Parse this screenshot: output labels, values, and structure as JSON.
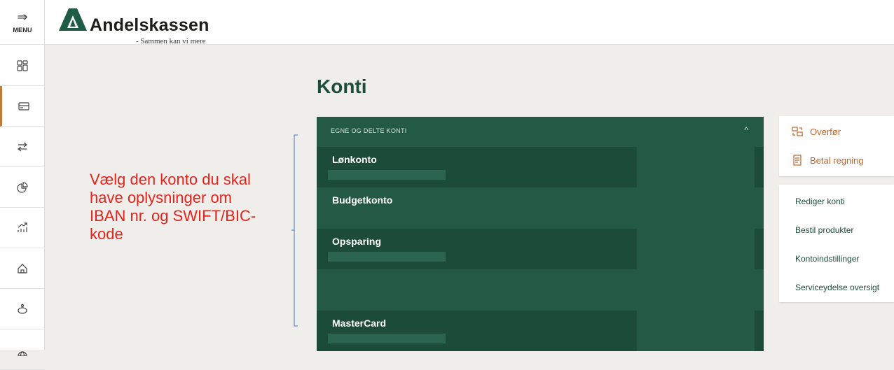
{
  "menu": {
    "label": "MENU"
  },
  "header": {
    "brand": "Andelskassen",
    "tagline": "- Sammen kan vi mere"
  },
  "page": {
    "title": "Konti"
  },
  "accounts": {
    "section_title": "EGNE OG DELTE KONTI",
    "items": [
      {
        "name": "Lønkonto"
      },
      {
        "name": "Budgetkonto"
      },
      {
        "name": "Opsparing"
      },
      {
        "name": "MasterCard"
      }
    ]
  },
  "annotation": {
    "text": "Vælg den konto du skal have oplysninger om IBAN nr. og SWIFT/BIC-kode"
  },
  "actions": {
    "transfer": "Overfør",
    "pay_bill": "Betal regning"
  },
  "links": {
    "edit_accounts": "Rediger konti",
    "order_products": "Bestil produkter",
    "account_settings": "Kontoindstillinger",
    "service_overview": "Serviceydelse oversigt"
  },
  "colors": {
    "brand_green": "#1e4d3a",
    "accent_orange": "#c0652b",
    "annotation_red": "#e8231c"
  }
}
